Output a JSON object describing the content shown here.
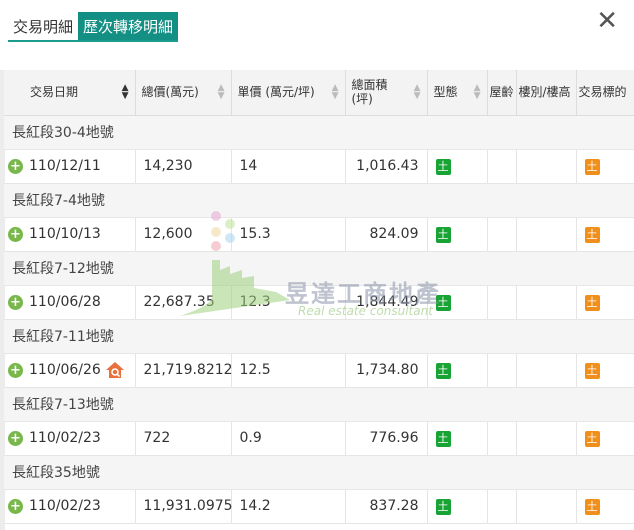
{
  "tabs": [
    {
      "label": "交易明細",
      "active": false
    },
    {
      "label": "歷次轉移明細",
      "active": true
    }
  ],
  "close_label": "✕",
  "columns": [
    {
      "label": "交易日期",
      "sort": "active"
    },
    {
      "label": "總價(萬元)",
      "sort": "both"
    },
    {
      "label": "單價 (萬元/坪)",
      "sort": "both"
    },
    {
      "label": "總面積\n(坪)",
      "sort": "both"
    },
    {
      "label": "型態",
      "sort": "both"
    },
    {
      "label": "屋齡",
      "sort": ""
    },
    {
      "label": "樓別/樓高",
      "sort": ""
    },
    {
      "label": "交易標的",
      "sort": ""
    }
  ],
  "groups": [
    {
      "name": "長紅段30-4地號",
      "date": "110/12/11",
      "total": "14,230",
      "unit": "14",
      "area": "1,016.43",
      "type_badge": "土",
      "age": "",
      "floor": "",
      "target_badge": "土",
      "house_icon": false
    },
    {
      "name": "長紅段7-4地號",
      "date": "110/10/13",
      "total": "12,600",
      "unit": "15.3",
      "area": "824.09",
      "type_badge": "土",
      "age": "",
      "floor": "",
      "target_badge": "土",
      "house_icon": false
    },
    {
      "name": "長紅段7-12地號",
      "date": "110/06/28",
      "total": "22,687.35",
      "unit": "12.3",
      "area": "1,844.49",
      "type_badge": "土",
      "age": "",
      "floor": "",
      "target_badge": "土",
      "house_icon": false
    },
    {
      "name": "長紅段7-11地號",
      "date": "110/06/26",
      "total": "21,719.8212",
      "unit": "12.5",
      "area": "1,734.80",
      "type_badge": "土",
      "age": "",
      "floor": "",
      "target_badge": "土",
      "house_icon": true
    },
    {
      "name": "長紅段7-13地號",
      "date": "110/02/23",
      "total": "722",
      "unit": "0.9",
      "area": "776.96",
      "type_badge": "土",
      "age": "",
      "floor": "",
      "target_badge": "土",
      "house_icon": false
    },
    {
      "name": "長紅段35地號",
      "date": "110/02/23",
      "total": "11,931.0975",
      "unit": "14.2",
      "area": "837.28",
      "type_badge": "土",
      "age": "",
      "floor": "",
      "target_badge": "土",
      "house_icon": false
    }
  ],
  "watermark": {
    "title": "昱達工商地產",
    "subtitle": "Real estate consultant"
  },
  "colors": {
    "tab_active": "#138f84",
    "type_badge": "#18a335",
    "target_badge": "#f08f1b",
    "expand": "#78b84a"
  }
}
